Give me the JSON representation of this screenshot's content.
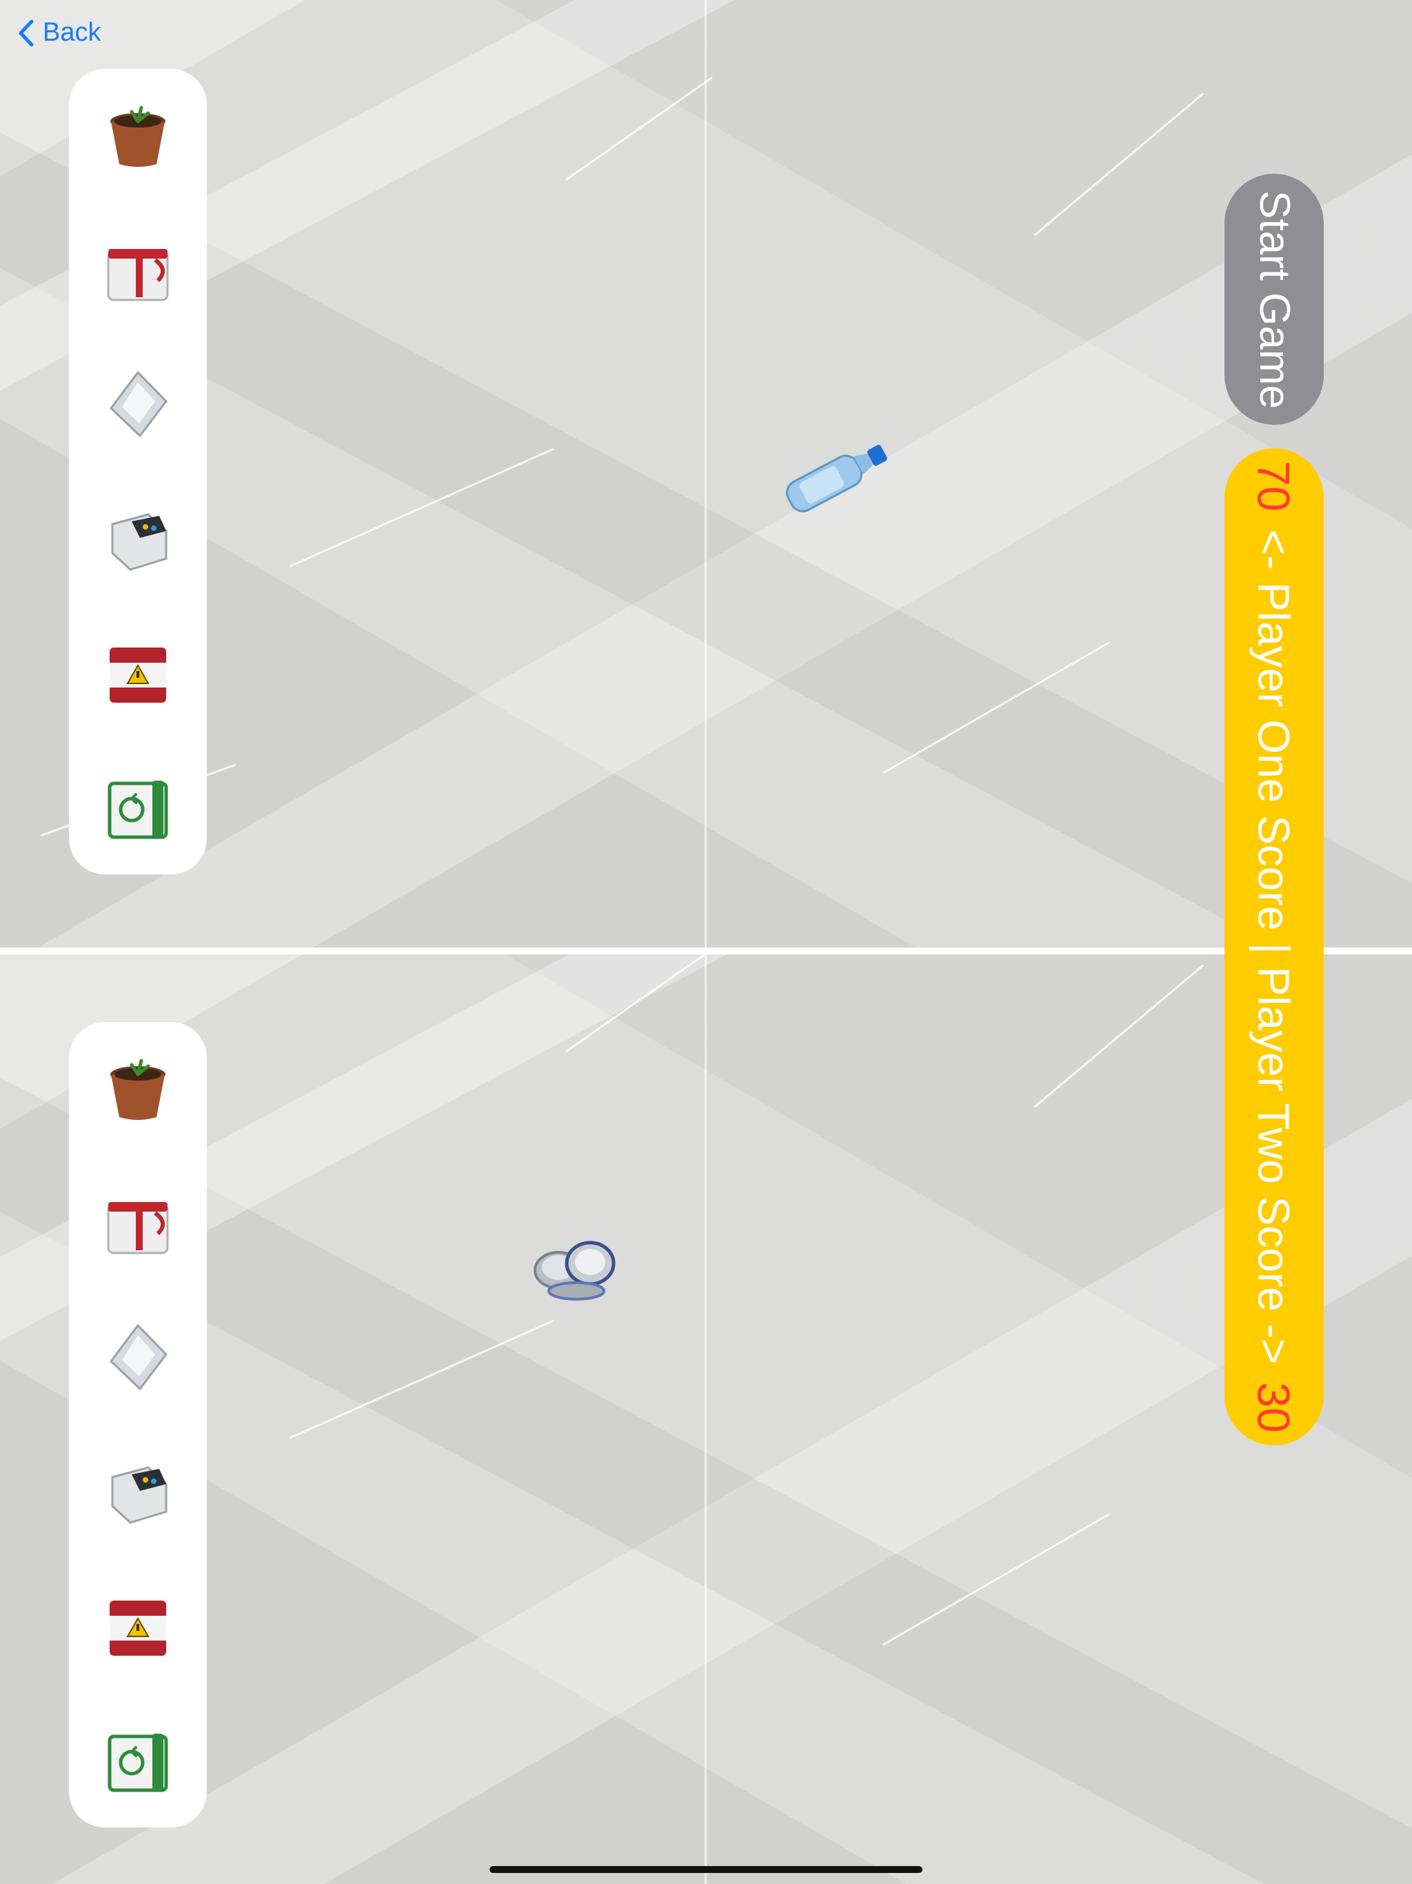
{
  "nav": {
    "back_label": "Back"
  },
  "start_button": {
    "label": "Start Game"
  },
  "scoreboard": {
    "player_one_score": "70",
    "label": "<- Player One Score | Player Two Score ->",
    "player_two_score": "30"
  },
  "bins": [
    {
      "name": "compost-pot",
      "icon": "plant-pot-icon"
    },
    {
      "name": "red-white-bin",
      "icon": "red-bin-icon"
    },
    {
      "name": "silver-diamond-bin",
      "icon": "silver-bin-icon"
    },
    {
      "name": "electronics-bin",
      "icon": "e-waste-bin-icon"
    },
    {
      "name": "hazard-bin",
      "icon": "hazard-bin-icon"
    },
    {
      "name": "recycle-bin",
      "icon": "recycle-bin-icon"
    }
  ],
  "items": {
    "player_one": "water-bottle-icon",
    "player_two": "metal-lids-icon"
  },
  "colors": {
    "accent": "#1a7bf0",
    "start_button": "#8e8e93",
    "score_pill": "#ffcc00",
    "score_number": "#ff3b30"
  }
}
